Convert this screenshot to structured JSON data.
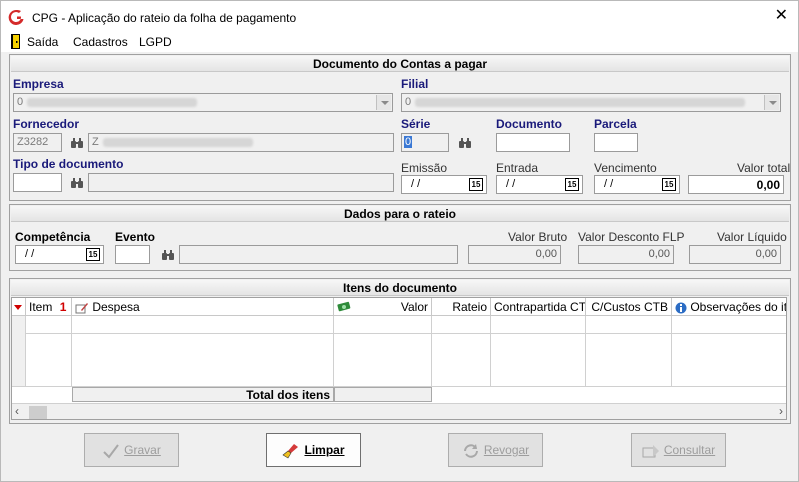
{
  "window": {
    "title": "CPG - Aplicação do rateio da folha de pagamento",
    "close": "✕"
  },
  "menu": {
    "items": [
      "Saída",
      "Cadastros",
      "LGPD"
    ]
  },
  "document_section": {
    "header": "Documento do Contas a pagar",
    "empresa": {
      "label": "Empresa",
      "value": "0"
    },
    "filial": {
      "label": "Filial",
      "value": "0"
    },
    "fornecedor": {
      "label": "Fornecedor",
      "code": "Z3282",
      "name": "Z"
    },
    "serie": {
      "label": "Série",
      "value": "0"
    },
    "documento": {
      "label": "Documento",
      "value": ""
    },
    "parcela": {
      "label": "Parcela",
      "value": ""
    },
    "tipo_documento": {
      "label": "Tipo de documento",
      "code": "",
      "name": ""
    },
    "emissao": {
      "label": "Emissão",
      "value": "/ /"
    },
    "entrada": {
      "label": "Entrada",
      "value": "/ /"
    },
    "vencimento": {
      "label": "Vencimento",
      "value": "/ /"
    },
    "valor_total": {
      "label": "Valor total",
      "value": "0,00"
    },
    "cal_glyph": "15"
  },
  "rateio_section": {
    "header": "Dados para o rateio",
    "competencia": {
      "label": "Competência",
      "value": "/ /"
    },
    "evento": {
      "label": "Evento",
      "code": "",
      "name": ""
    },
    "valor_bruto": {
      "label": "Valor Bruto",
      "value": "0,00"
    },
    "valor_desconto": {
      "label": "Valor Desconto FLP",
      "value": "0,00"
    },
    "valor_liquido": {
      "label": "Valor Líquido",
      "value": "0,00"
    }
  },
  "items_section": {
    "header": "Itens do documento",
    "columns": {
      "item": "Item",
      "sort_marker": "1",
      "despesa": "Despesa",
      "valor": "Valor",
      "rateio": "Rateio",
      "contrapartida": "Contrapartida CTB",
      "ccustos": "C/Custos CTB",
      "observacoes": "Observações do item"
    },
    "total_label": "Total dos itens"
  },
  "buttons": {
    "gravar": "Gravar",
    "limpar": "Limpar",
    "revogar": "Revogar",
    "consultar": "Consultar"
  },
  "colors": {
    "label_blue": "#1a1a7a",
    "app_icon_red": "#d42a2a",
    "excel_green": "#2e8b3a"
  }
}
